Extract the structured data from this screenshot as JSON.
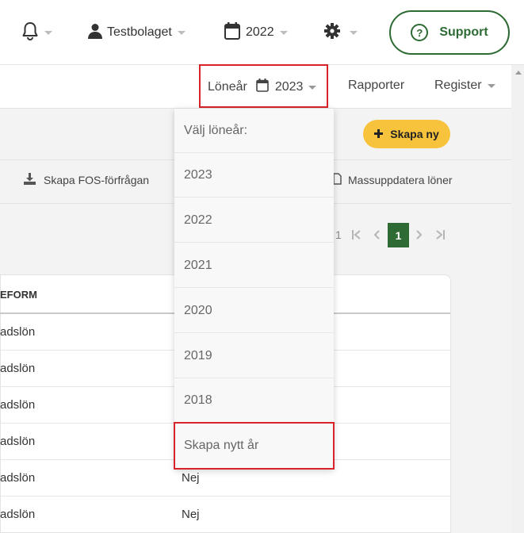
{
  "topbar": {
    "company": "Testbolaget",
    "year": "2022",
    "support_label": "Support",
    "support_icon_glyph": "?"
  },
  "subnav": {
    "payroll_year_label": "Löneår",
    "payroll_year_value": "2023",
    "reports_label": "Rapporter",
    "register_label": "Register"
  },
  "actions": {
    "create_new_label": "Skapa ny",
    "fos_label": "Skapa FOS-förfrågan",
    "mass_update_label": "Massuppdatera löner"
  },
  "pager": {
    "pages_label": "1",
    "current_page": "1"
  },
  "table": {
    "column_header": "EFORM",
    "rows": [
      {
        "form": "adslön",
        "value": ""
      },
      {
        "form": "adslön",
        "value": ""
      },
      {
        "form": "adslön",
        "value": ""
      },
      {
        "form": "adslön",
        "value": ""
      },
      {
        "form": "adslön",
        "value": "Nej"
      },
      {
        "form": "adslön",
        "value": "Nej"
      }
    ]
  },
  "dropdown": {
    "heading": "Välj löneår:",
    "years": [
      "2023",
      "2022",
      "2021",
      "2020",
      "2019",
      "2018"
    ],
    "create_year_label": "Skapa nytt år"
  },
  "colors": {
    "brand_green": "#2e6b34",
    "accent_yellow": "#f7c23c",
    "highlight_red": "#d9232a"
  }
}
